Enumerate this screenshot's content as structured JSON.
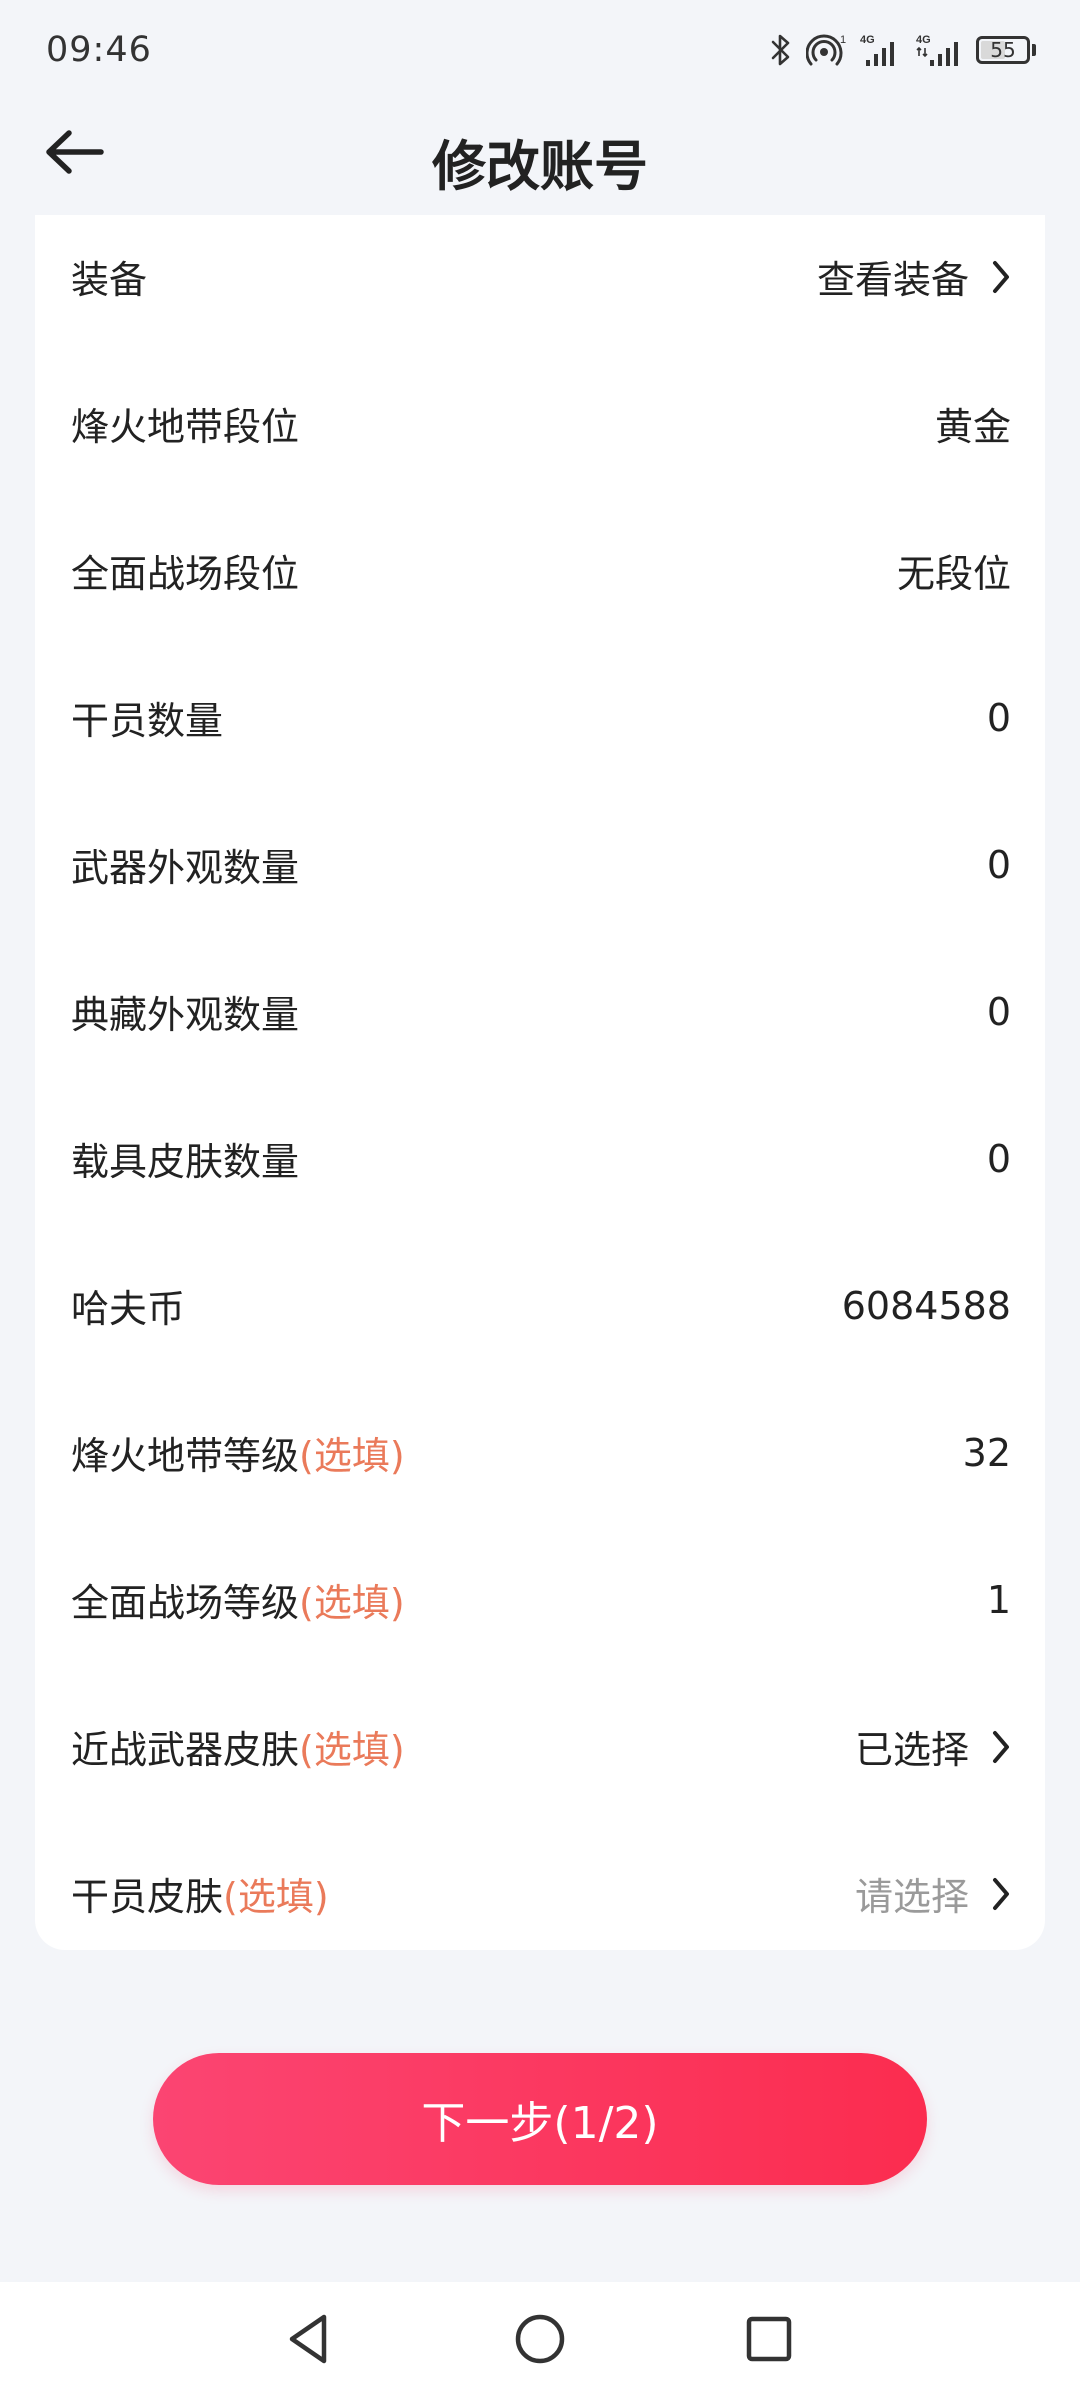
{
  "status_bar": {
    "time": "09:46",
    "battery": "55",
    "battery_level": 0.55,
    "icons": [
      "bluetooth-icon",
      "hotspot-icon",
      "signal-4g-icon",
      "signal-4g-2-icon",
      "battery-icon"
    ],
    "hotspot_badge": "1",
    "network_1": "4G",
    "network_2": "4G"
  },
  "header": {
    "title": "修改账号",
    "back_icon": "arrow-left-icon"
  },
  "colors": {
    "accent": "#fb2c4f",
    "optional": "#ea7a5a",
    "placeholder": "#9a9a9a",
    "background": "#f3f5f9"
  },
  "form": {
    "rows": [
      {
        "label": "装备",
        "optional": "",
        "value": "查看装备",
        "chevron": true
      },
      {
        "label": "烽火地带段位",
        "optional": "",
        "value": "黄金",
        "chevron": false
      },
      {
        "label": "全面战场段位",
        "optional": "",
        "value": "无段位",
        "chevron": false
      },
      {
        "label": "干员数量",
        "optional": "",
        "value": "0",
        "chevron": false
      },
      {
        "label": "武器外观数量",
        "optional": "",
        "value": "0",
        "chevron": false
      },
      {
        "label": "典藏外观数量",
        "optional": "",
        "value": "0",
        "chevron": false
      },
      {
        "label": "载具皮肤数量",
        "optional": "",
        "value": "0",
        "chevron": false
      },
      {
        "label": "哈夫币",
        "optional": "",
        "value": "6084588",
        "chevron": false
      },
      {
        "label": "烽火地带等级",
        "optional": "(选填)",
        "value": "32",
        "chevron": false
      },
      {
        "label": "全面战场等级",
        "optional": "(选填)",
        "value": "1",
        "chevron": false
      },
      {
        "label": "近战武器皮肤",
        "optional": "(选填)",
        "value": "已选择",
        "chevron": true
      },
      {
        "label": "干员皮肤",
        "optional": "(选填)",
        "value": "请选择",
        "chevron": true,
        "placeholder": true
      }
    ]
  },
  "next_button": {
    "label": "下一步(1/2)"
  },
  "nav_bar": {
    "icons": [
      "back-triangle-icon",
      "home-circle-icon",
      "recents-square-icon"
    ]
  }
}
